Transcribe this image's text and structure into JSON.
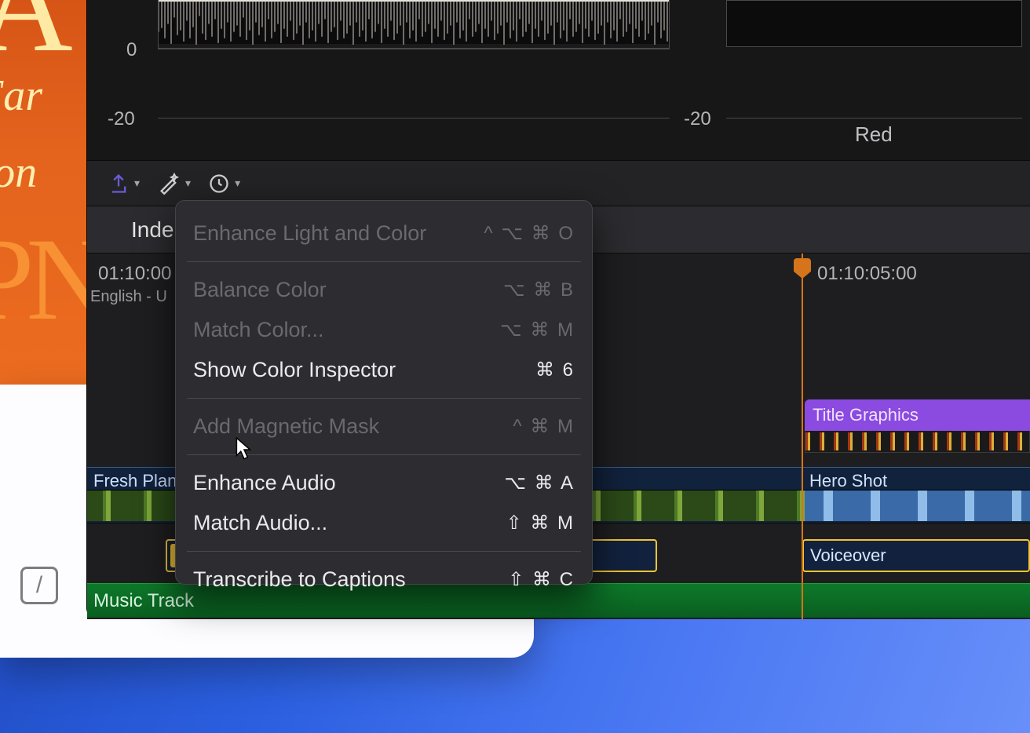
{
  "side_art": {
    "glyph": "A",
    "line1": "Far",
    "line2": "tion",
    "line3": "PN"
  },
  "pencil_glyph": "/",
  "scope": {
    "tick0": "0",
    "tickN20_left": "-20",
    "tickN20_right": "-20",
    "red_label": "Red"
  },
  "toolbar": {
    "index_label": "Inde"
  },
  "timeline": {
    "tc_left": "01:10:00",
    "tc_sub": "English - U",
    "tc_right": "01:10:05:00",
    "title_clip": "Title Graphics",
    "clip_left": "Fresh Plan",
    "clip_right": "Hero Shot",
    "voiceover": "Voiceover",
    "music": "Music Track"
  },
  "menu": {
    "enhance_light": {
      "label": "Enhance Light and Color",
      "shortcut": "^ ⌥ ⌘ O"
    },
    "balance_color": {
      "label": "Balance Color",
      "shortcut": "⌥ ⌘ B"
    },
    "match_color": {
      "label": "Match Color...",
      "shortcut": "⌥ ⌘ M"
    },
    "show_color_inspector": {
      "label": "Show Color Inspector",
      "shortcut": "⌘ 6"
    },
    "add_magnetic_mask": {
      "label": "Add Magnetic Mask",
      "shortcut": "^ ⌘ M"
    },
    "enhance_audio": {
      "label": "Enhance Audio",
      "shortcut": "⌥ ⌘ A"
    },
    "match_audio": {
      "label": "Match Audio...",
      "shortcut": "⇧ ⌘ M"
    },
    "transcribe": {
      "label": "Transcribe to Captions",
      "shortcut": "⇧ ⌘ C"
    }
  }
}
